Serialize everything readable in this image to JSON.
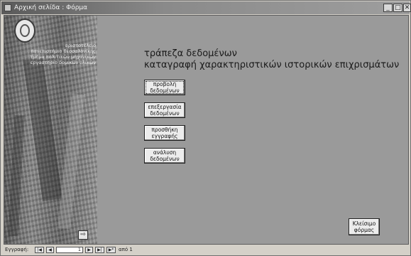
{
  "window": {
    "title": "Αρχική σελίδα : Φόρμα",
    "minimize_glyph": "_",
    "maximize_glyph": "□",
    "close_glyph": "✕"
  },
  "sidebar": {
    "org_lines": [
      "αριστοτέλειο",
      "πανεπιστήμιο θεσσαλονίκης",
      "τμήμα πολιτικών μηχανικών",
      "εργαστήριο δομικών υλικών"
    ],
    "exit_icon": "exit-door-icon",
    "exit_glyph": "⇨"
  },
  "main": {
    "heading_line1": "τράπεζα δεδομένων",
    "heading_line2": "καταγραφή χαρακτηριστικών ιστορικών επιχρισμάτων",
    "buttons": [
      {
        "line1": "προβολή",
        "line2": "δεδομένων"
      },
      {
        "line1": "επεξεργασία",
        "line2": "δεδομένων"
      },
      {
        "line1": "προσθήκη",
        "line2": "εγγραφής"
      },
      {
        "line1": "ανάλυση",
        "line2": "δεδομένων"
      }
    ],
    "close_button": {
      "line1": "Κλείσιμο",
      "line2": "φόρμας"
    }
  },
  "navbar": {
    "record_label": "Εγγραφή:",
    "first_glyph": "|◀",
    "prev_glyph": "◀",
    "current_record": "1",
    "next_glyph": "▶",
    "last_glyph": "▶|",
    "new_glyph": "▶*",
    "of_label": "από 1"
  }
}
